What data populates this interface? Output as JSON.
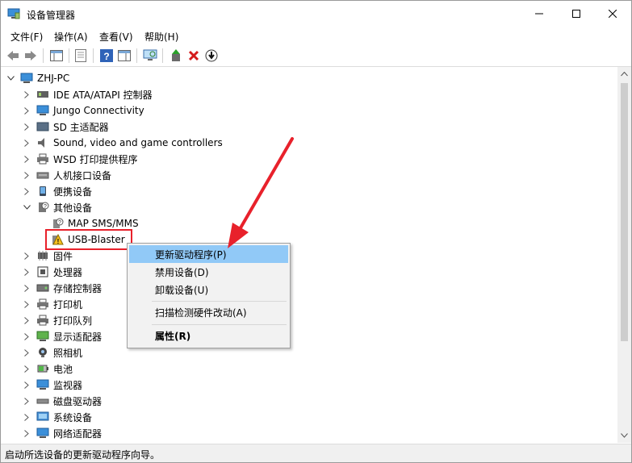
{
  "window": {
    "title": "设备管理器"
  },
  "menu": [
    "文件(F)",
    "操作(A)",
    "查看(V)",
    "帮助(H)"
  ],
  "root": "ZHJ-PC",
  "tree": [
    {
      "label": "IDE ATA/ATAPI 控制器",
      "icon": "ide-icon"
    },
    {
      "label": "Jungo Connectivity",
      "icon": "jungo-icon"
    },
    {
      "label": "SD 主适配器",
      "icon": "sd-icon"
    },
    {
      "label": "Sound, video and game controllers",
      "icon": "sound-icon"
    },
    {
      "label": "WSD 打印提供程序",
      "icon": "printer-icon"
    },
    {
      "label": "人机接口设备",
      "icon": "hid-icon"
    },
    {
      "label": "便携设备",
      "icon": "portable-icon"
    },
    {
      "label": "其他设备",
      "icon": "other-device-icon",
      "expanded": true
    },
    {
      "label": "MAP SMS/MMS",
      "icon": "unknown-device-icon",
      "child": true
    },
    {
      "label": "USB-Blaster",
      "icon": "warning-device-icon",
      "child": true
    },
    {
      "label": "固件",
      "icon": "firmware-icon"
    },
    {
      "label": "处理器",
      "icon": "cpu-icon"
    },
    {
      "label": "存储控制器",
      "icon": "storage-icon"
    },
    {
      "label": "打印机",
      "icon": "printer-icon"
    },
    {
      "label": "打印队列",
      "icon": "print-queue-icon"
    },
    {
      "label": "显示适配器",
      "icon": "display-icon"
    },
    {
      "label": "照相机",
      "icon": "camera-icon"
    },
    {
      "label": "电池",
      "icon": "battery-icon"
    },
    {
      "label": "监视器",
      "icon": "monitor-icon"
    },
    {
      "label": "磁盘驱动器",
      "icon": "disk-icon"
    },
    {
      "label": "系统设备",
      "icon": "system-icon"
    },
    {
      "label": "网络适配器",
      "icon": "network-icon"
    }
  ],
  "context_menu": {
    "update": "更新驱动程序(P)",
    "disable": "禁用设备(D)",
    "uninstall": "卸载设备(U)",
    "scan": "扫描检测硬件改动(A)",
    "properties": "属性(R)"
  },
  "status": "启动所选设备的更新驱动程序向导。",
  "colors": {
    "highlight": "#91c9f7",
    "annotation": "#e8212b"
  }
}
